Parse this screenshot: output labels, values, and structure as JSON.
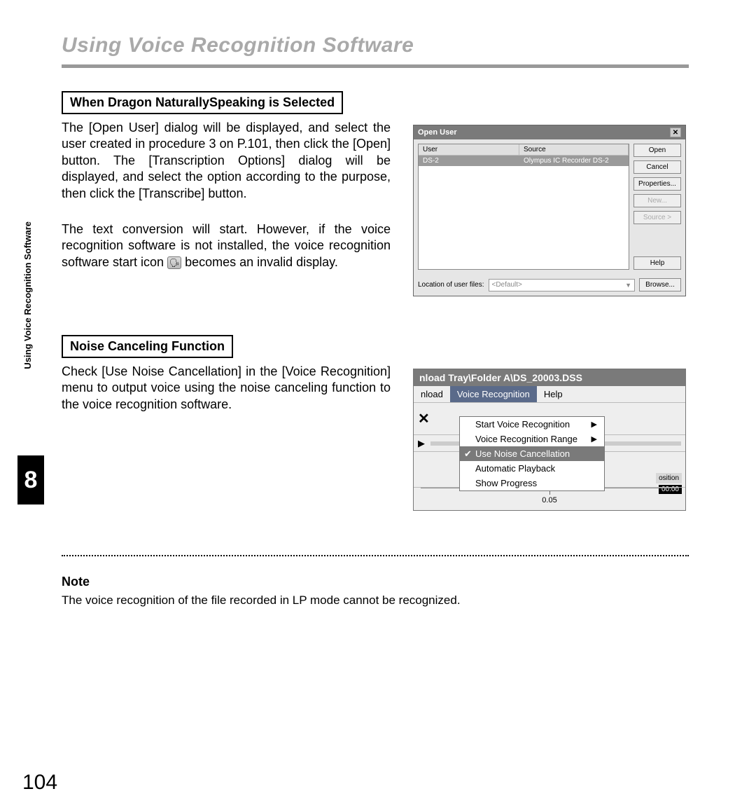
{
  "page": {
    "title": "Using Voice Recognition Software",
    "side_label": "Using Voice Recognition Software",
    "chapter": "8",
    "page_number": "104"
  },
  "section1": {
    "heading": "When Dragon NaturallySpeaking is Selected",
    "para1": "The [Open User] dialog will be displayed, and select the user created in procedure 3 on P.101, then click the [Open] button.  The [Transcription Options] dialog will be displayed, and select the option according to the purpose, then click the [Transcribe] button.",
    "para2a": "The text conversion will start.  However, if the voice recognition software is not installed, the voice recognition software start icon ",
    "para2b": " becomes an invalid display."
  },
  "section2": {
    "heading": "Noise Canceling Function",
    "para": "Check [Use Noise Cancellation] in the [Voice Recognition] menu to output voice using the noise canceling function to the voice recognition software."
  },
  "dialog": {
    "title": "Open User",
    "columns": {
      "user": "User",
      "source": "Source"
    },
    "row": {
      "user": "DS-2",
      "source": "Olympus IC Recorder DS-2"
    },
    "buttons": {
      "open": "Open",
      "cancel": "Cancel",
      "properties": "Properties...",
      "new": "New...",
      "source": "Source >",
      "help": "Help",
      "browse": "Browse..."
    },
    "footer_label": "Location of user files:",
    "footer_value": "<Default>"
  },
  "menu": {
    "titlebar": "nload Tray\\Folder A\\DS_20003.DSS",
    "bar": {
      "nload": "nload",
      "voice_recognition": "Voice Recognition",
      "help": "Help"
    },
    "items": {
      "start": "Start Voice Recognition",
      "range": "Voice Recognition Range",
      "use_noise": "Use Noise Cancellation",
      "auto_playback": "Automatic Playback",
      "show_progress": "Show Progress"
    },
    "side": {
      "position": "osition",
      "time": "00:00"
    },
    "ruler_tick": "0.05"
  },
  "note": {
    "title": "Note",
    "text": "The voice recognition of the file recorded in LP mode cannot be recognized."
  }
}
